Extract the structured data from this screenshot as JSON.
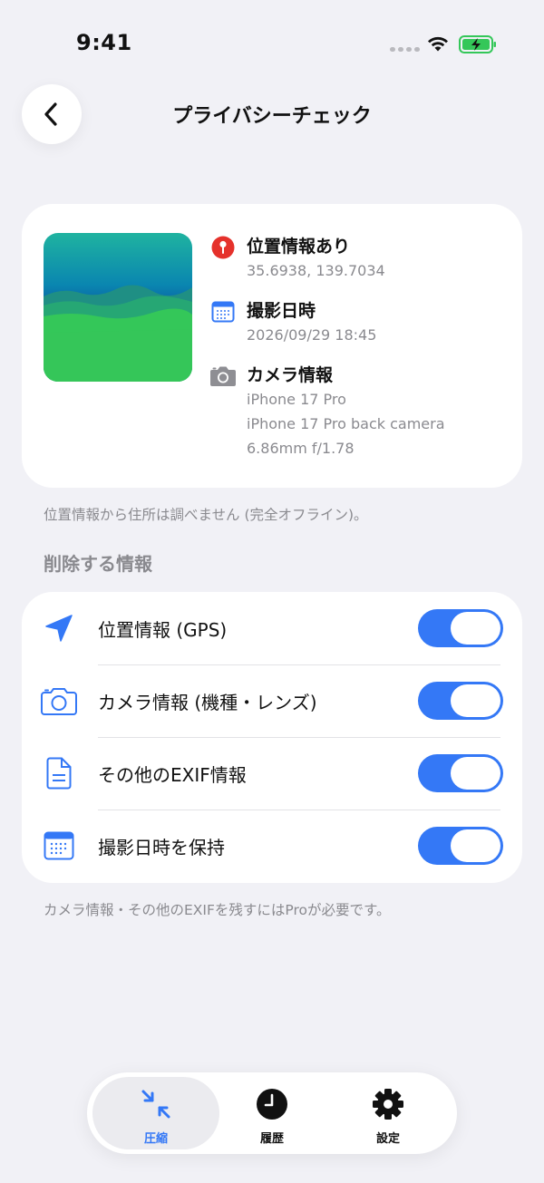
{
  "status_bar": {
    "time": "9:41"
  },
  "nav": {
    "title": "プライバシーチェック"
  },
  "metadata": {
    "location": {
      "title": "位置情報あり",
      "value": "35.6938, 139.7034"
    },
    "datetime": {
      "title": "撮影日時",
      "value": "2026/09/29 18:45"
    },
    "camera": {
      "title": "カメラ情報",
      "model": "iPhone 17 Pro",
      "lens": "iPhone 17 Pro back camera",
      "specs": "6.86mm f/1.78"
    }
  },
  "offline_note": "位置情報から住所は調べません (完全オフライン)。",
  "remove_section": {
    "header": "削除する情報",
    "items": [
      {
        "label": "位置情報 (GPS)",
        "on": true
      },
      {
        "label": "カメラ情報 (機種・レンズ)",
        "on": true
      },
      {
        "label": "その他のEXIF情報",
        "on": true
      },
      {
        "label": "撮影日時を保持",
        "on": true
      }
    ]
  },
  "pro_note": "カメラ情報・その他のEXIFを残すにはProが必要です。",
  "tab_bar": {
    "tabs": [
      {
        "label": "圧縮",
        "icon": "compress-icon",
        "selected": true
      },
      {
        "label": "履歴",
        "icon": "clock-icon",
        "selected": false
      },
      {
        "label": "設定",
        "icon": "gear-icon",
        "selected": false
      }
    ]
  },
  "colors": {
    "accent": "#3478f6",
    "background": "#f1f1f6",
    "location_pin": "#e5312b",
    "secondary_text": "#8a8a8f"
  }
}
